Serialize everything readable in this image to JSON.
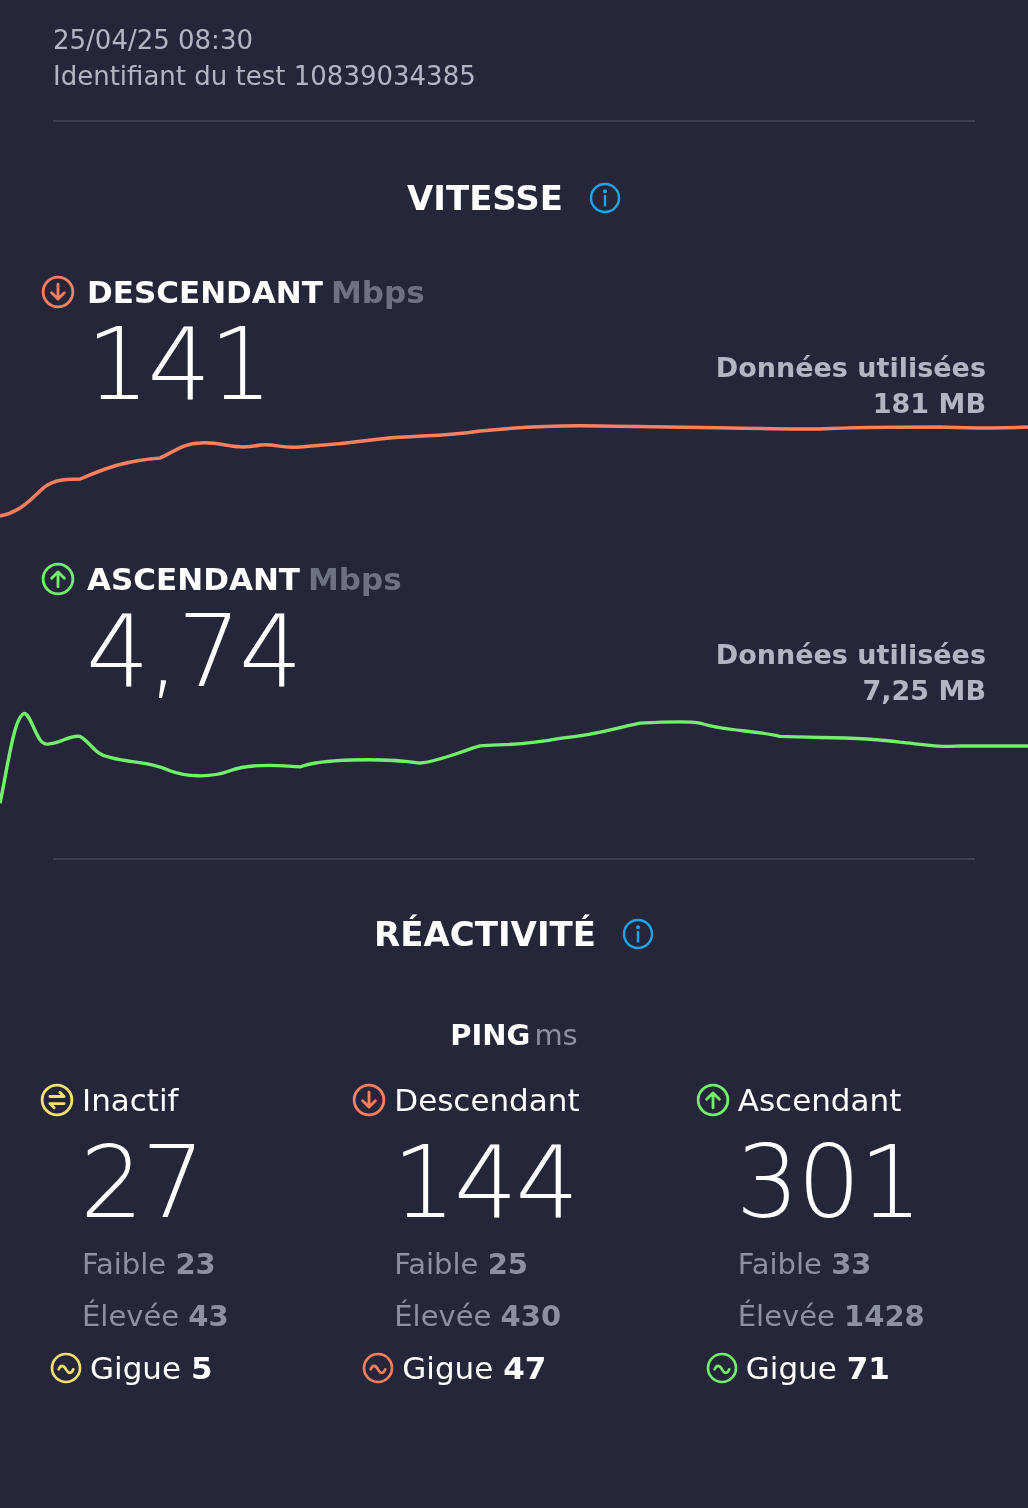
{
  "header": {
    "date": "25/04/25 08:30",
    "test_id": "Identifiant du test 10839034385"
  },
  "speed": {
    "title": "VITESSE",
    "results": [
      {
        "kind": "download",
        "label": "DESCENDANT",
        "unit": "Mbps",
        "value": "141",
        "data_used": "Données utilisées 181 MB"
      },
      {
        "kind": "upload",
        "label": "ASCENDANT",
        "unit": "Mbps",
        "value": "4,74",
        "data_used": "Données utilisées 7,25 MB"
      }
    ]
  },
  "responsiveness": {
    "title": "RÉACTIVITÉ",
    "ping_label": "PING",
    "ping_unit": "ms",
    "columns": [
      {
        "kind": "idle",
        "label": "Inactif",
        "value": "27",
        "low": "Faible **23**",
        "high": "Élevée **43**",
        "jitter": "Gigue **5**"
      },
      {
        "kind": "download",
        "label": "Descendant",
        "value": "144",
        "low": "Faible **25**",
        "high": "Élevée **430**",
        "jitter": "Gigue **47**"
      },
      {
        "kind": "upload",
        "label": "Ascendant",
        "value": "301",
        "low": "Faible **33**",
        "high": "Élevée **1428**",
        "jitter": "Gigue **71**"
      }
    ]
  }
}
